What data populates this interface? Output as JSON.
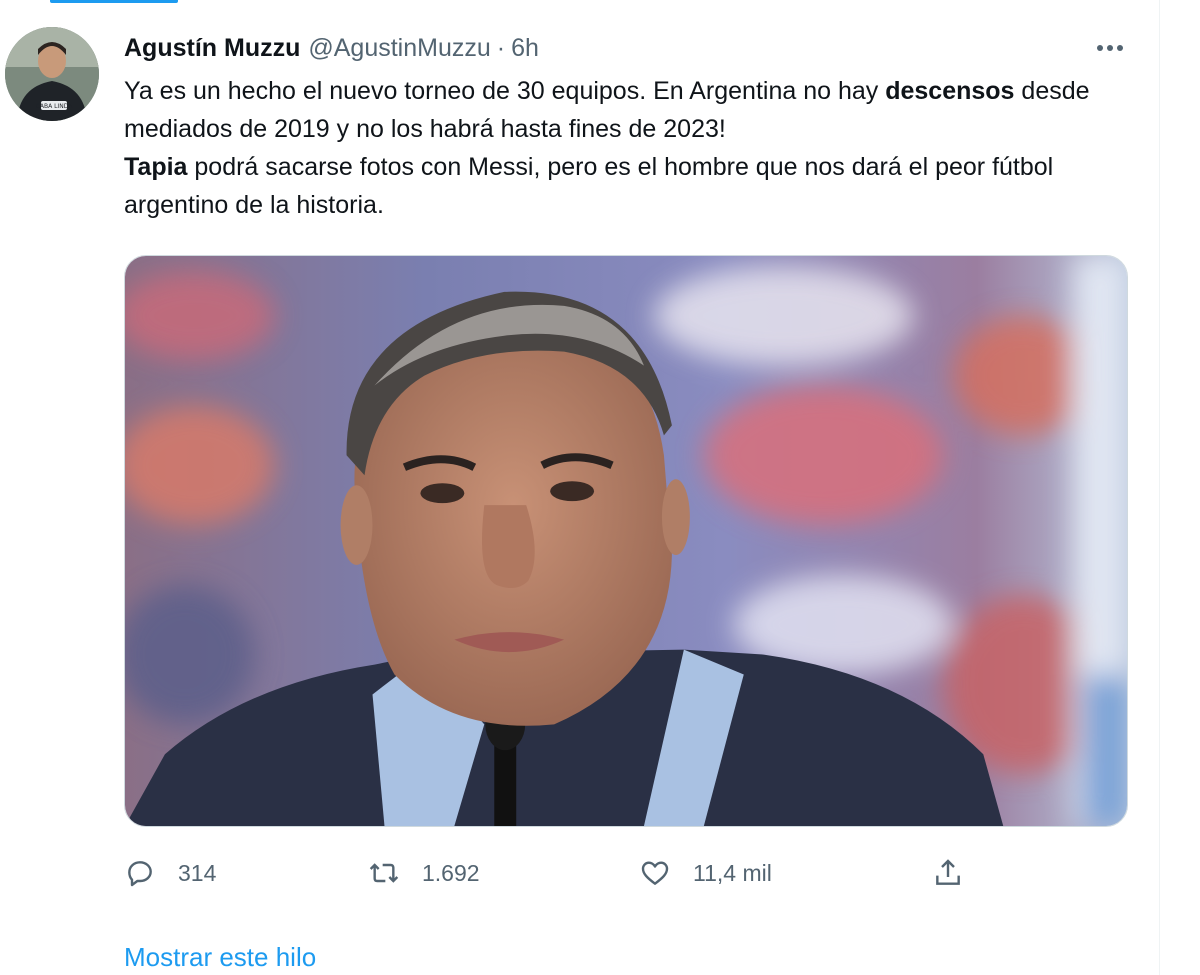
{
  "tweet": {
    "author_name": "Agustín Muzzu",
    "author_handle": "@AgustinMuzzu",
    "separator": "·",
    "time": "6h",
    "text": {
      "part1": "Ya es un hecho el nuevo torneo de 30 equipos. En Argentina no hay ",
      "bold1": "descensos",
      "part2": " desde mediados de 2019 y no los habrá hasta fines de 2023! ",
      "bold2": "Tapia",
      "part3": " podrá sacarse fotos con Messi, pero es el hombre que nos dará el peor fútbol argentino de la historia."
    },
    "more_icon": "more-horizontal-icon",
    "avatar_badge_text": "CABA LINDA",
    "media_alt": "Photo of a man speaking into a microphone at a press conference"
  },
  "actions": {
    "reply": {
      "icon": "reply-icon",
      "count": "314"
    },
    "retweet": {
      "icon": "retweet-icon",
      "count": "1.692"
    },
    "like": {
      "icon": "heart-icon",
      "count": "11,4 mil"
    },
    "share": {
      "icon": "share-icon"
    }
  },
  "show_thread_label": "Mostrar este hilo",
  "colors": {
    "accent": "#1d9bf0",
    "text_primary": "#0f1419",
    "text_secondary": "#536471",
    "border": "#cfd9de"
  }
}
